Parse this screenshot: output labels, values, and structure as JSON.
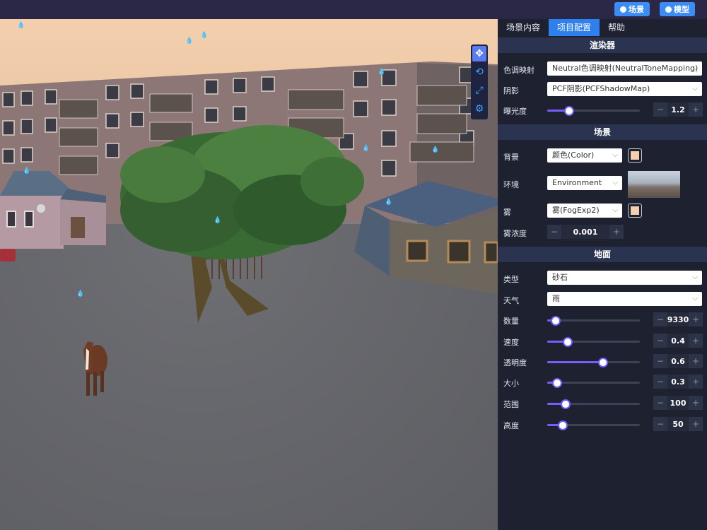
{
  "topbar": {
    "scene_button": "场景",
    "model_button": "模型"
  },
  "toolstrip": {
    "icons": [
      "move-icon",
      "rotate-icon",
      "scale-icon",
      "settings-icon"
    ]
  },
  "tabs": [
    "场景内容",
    "项目配置",
    "帮助"
  ],
  "active_tab": "项目配置",
  "renderer": {
    "title": "渲染器",
    "tone_mapping": {
      "label": "色调映射",
      "value": "Neutral色调映射(NeutralToneMapping)"
    },
    "shadow": {
      "label": "阴影",
      "value": "PCF阴影(PCFShadowMap)"
    },
    "exposure": {
      "label": "曝光度",
      "value": "1.2",
      "fraction": 0.24
    }
  },
  "scene": {
    "title": "场景",
    "background": {
      "label": "背景",
      "value": "颜色(Color)",
      "color": "#f2cfae"
    },
    "environment": {
      "label": "环境",
      "value": "Environment"
    },
    "fog": {
      "label": "雾",
      "value": "雾(FogExp2)",
      "color": "#f2cfae"
    },
    "fog_density": {
      "label": "雾浓度",
      "value": "0.001"
    }
  },
  "ground": {
    "title": "地面",
    "type": {
      "label": "类型",
      "value": "砂石"
    },
    "weather": {
      "label": "天气",
      "value": "雨"
    },
    "sliders": [
      {
        "label": "数量",
        "value": "9330",
        "fraction": 0.09
      },
      {
        "label": "速度",
        "value": "0.4",
        "fraction": 0.22
      },
      {
        "label": "透明度",
        "value": "0.6",
        "fraction": 0.6
      },
      {
        "label": "大小",
        "value": "0.3",
        "fraction": 0.11
      },
      {
        "label": "范围",
        "value": "100",
        "fraction": 0.2
      },
      {
        "label": "高度",
        "value": "50",
        "fraction": 0.17
      }
    ]
  },
  "stepper_minus": "−",
  "stepper_plus": "+",
  "chevron": "⌵"
}
